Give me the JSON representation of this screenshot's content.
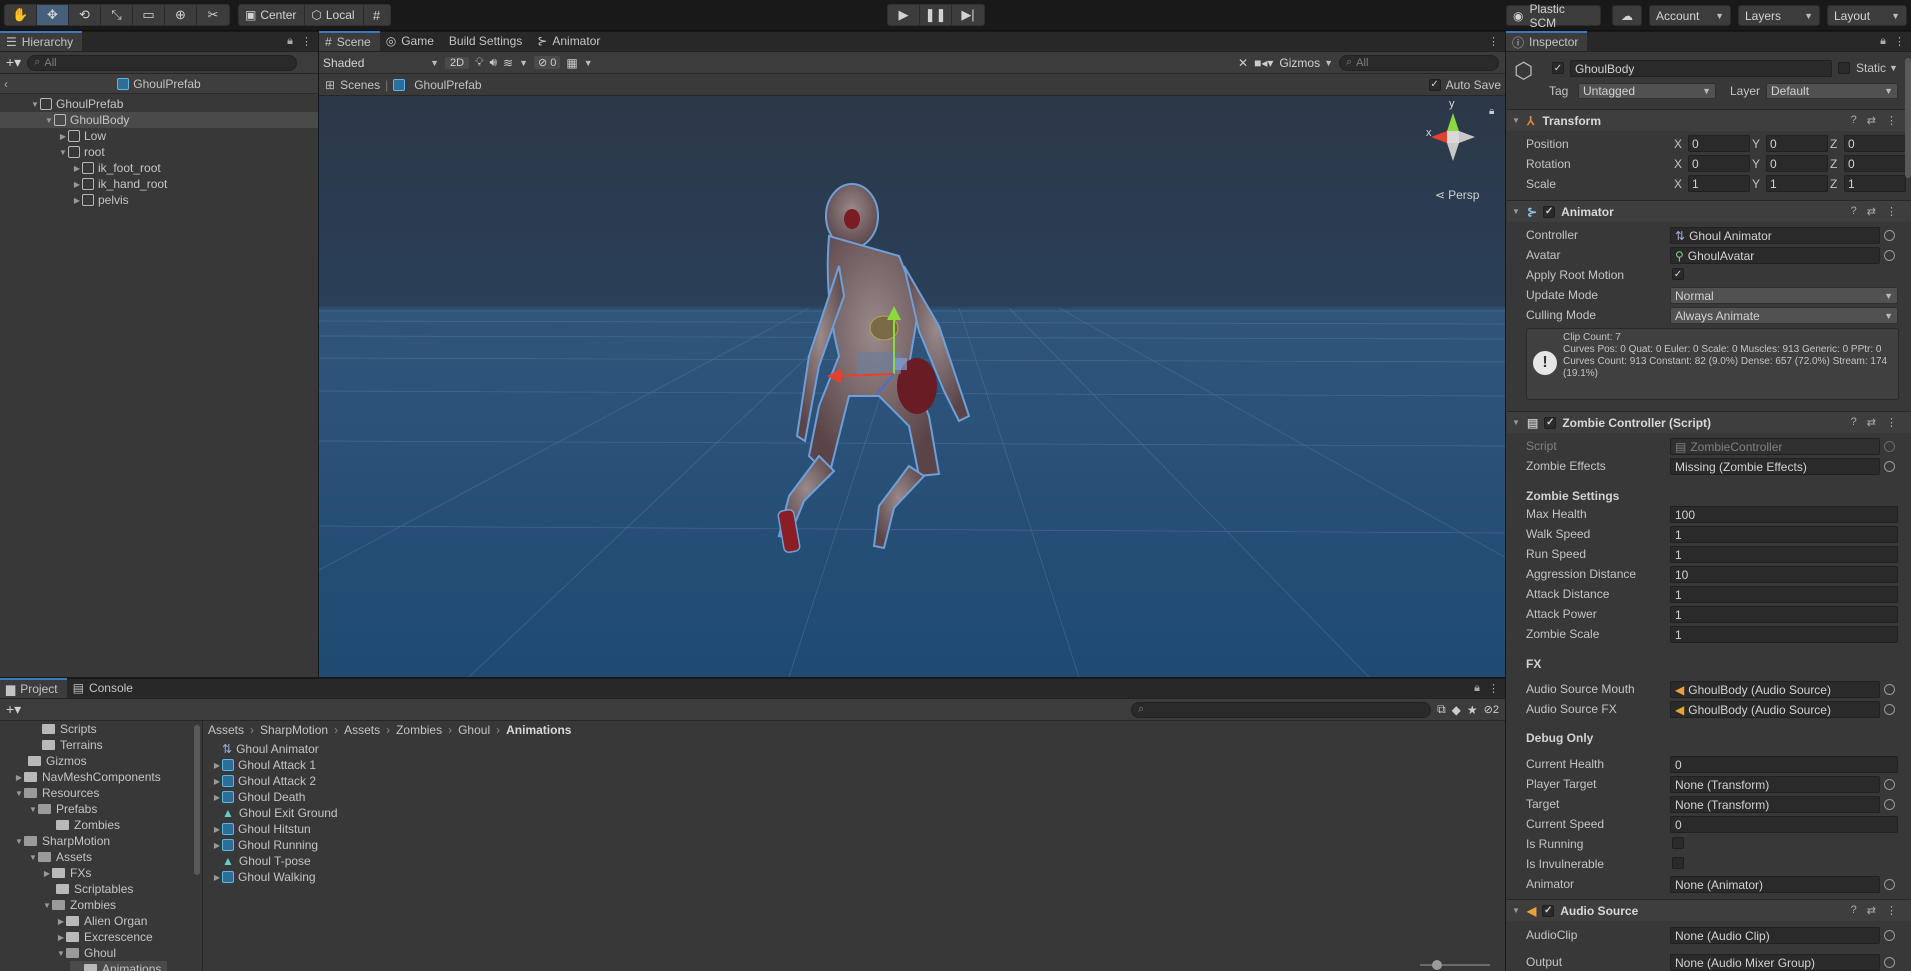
{
  "toolbar": {
    "pivot_label": "Center",
    "space_label": "Local",
    "plastic_label": "Plastic SCM",
    "account_label": "Account",
    "layers_label": "Layers",
    "layout_label": "Layout"
  },
  "hierarchy": {
    "tab": "Hierarchy",
    "search_placeholder": "All",
    "prefab_title": "GhoulPrefab",
    "items": [
      {
        "label": "GhoulPrefab"
      },
      {
        "label": "GhoulBody"
      },
      {
        "label": "Low"
      },
      {
        "label": "root"
      },
      {
        "label": "ik_foot_root"
      },
      {
        "label": "ik_hand_root"
      },
      {
        "label": "pelvis"
      }
    ]
  },
  "scene_tabs": {
    "scene": "Scene",
    "game": "Game",
    "build": "Build Settings",
    "animator": "Animator"
  },
  "scene_bar": {
    "shading": "Shaded",
    "mode2d": "2D",
    "hidden_count": "0",
    "gizmos": "Gizmos",
    "search_placeholder": "All",
    "breadcrumb_root": "Scenes",
    "breadcrumb_prefab": "GhoulPrefab",
    "autosave": "Auto Save",
    "persp": "Persp",
    "axis_x": "x",
    "axis_y": "y"
  },
  "inspector": {
    "tab": "Inspector",
    "object_name": "GhoulBody",
    "static_label": "Static",
    "tag_label": "Tag",
    "tag_value": "Untagged",
    "layer_label": "Layer",
    "layer_value": "Default",
    "transform": {
      "title": "Transform",
      "position_label": "Position",
      "rotation_label": "Rotation",
      "scale_label": "Scale",
      "position": [
        "0",
        "0",
        "0"
      ],
      "rotation": [
        "0",
        "0",
        "0"
      ],
      "scale": [
        "1",
        "1",
        "1"
      ]
    },
    "animator": {
      "title": "Animator",
      "controller_label": "Controller",
      "controller_value": "Ghoul Animator",
      "avatar_label": "Avatar",
      "avatar_value": "GhoulAvatar",
      "apply_root_label": "Apply Root Motion",
      "update_label": "Update Mode",
      "update_value": "Normal",
      "culling_label": "Culling Mode",
      "culling_value": "Always Animate",
      "info_line1": "Clip Count: 7",
      "info_line2": "Curves Pos: 0 Quat: 0 Euler: 0 Scale: 0 Muscles: 913 Generic: 0 PPtr: 0",
      "info_line3": "Curves Count: 913 Constant: 82 (9.0%) Dense: 657 (72.0%) Stream: 174 (19.1%)"
    },
    "zombie": {
      "title": "Zombie Controller (Script)",
      "script_label": "Script",
      "script_value": "ZombieController",
      "effects_label": "Zombie Effects",
      "effects_value": "Missing (Zombie Effects)",
      "settings_header": "Zombie Settings",
      "max_health_label": "Max Health",
      "max_health": "100",
      "walk_speed_label": "Walk Speed",
      "walk_speed": "1",
      "run_speed_label": "Run Speed",
      "run_speed": "1",
      "aggression_label": "Aggression Distance",
      "aggression": "10",
      "attack_distance_label": "Attack Distance",
      "attack_distance": "1",
      "attack_power_label": "Attack Power",
      "attack_power": "1",
      "zombie_scale_label": "Zombie Scale",
      "zombie_scale": "1",
      "fx_header": "FX",
      "audio_mouth_label": "Audio Source Mouth",
      "audio_mouth_value": "GhoulBody (Audio Source)",
      "audio_fx_label": "Audio Source FX",
      "audio_fx_value": "GhoulBody (Audio Source)",
      "debug_header": "Debug Only",
      "current_health_label": "Current Health",
      "current_health": "0",
      "player_target_label": "Player Target",
      "player_target": "None (Transform)",
      "target_label": "Target",
      "target": "None (Transform)",
      "current_speed_label": "Current Speed",
      "current_speed": "0",
      "is_running_label": "Is Running",
      "is_invulnerable_label": "Is Invulnerable",
      "animator_label": "Animator",
      "animator_value": "None (Animator)"
    },
    "audio": {
      "title": "Audio Source",
      "clip_label": "AudioClip",
      "clip_value": "None (Audio Clip)",
      "output_label": "Output",
      "output_value": "None (Audio Mixer Group)"
    }
  },
  "project": {
    "tab_project": "Project",
    "tab_console": "Console",
    "hidden_count": "2",
    "tree": [
      {
        "label": "Scripts"
      },
      {
        "label": "Terrains"
      },
      {
        "label": "Gizmos"
      },
      {
        "label": "NavMeshComponents"
      },
      {
        "label": "Resources"
      },
      {
        "label": "Prefabs"
      },
      {
        "label": "Zombies"
      },
      {
        "label": "SharpMotion"
      },
      {
        "label": "Assets"
      },
      {
        "label": "FXs"
      },
      {
        "label": "Scriptables"
      },
      {
        "label": "Zombies"
      },
      {
        "label": "Alien Organ"
      },
      {
        "label": "Excrescence"
      },
      {
        "label": "Ghoul"
      },
      {
        "label": "Animations"
      }
    ],
    "breadcrumb": [
      "Assets",
      "SharpMotion",
      "Assets",
      "Zombies",
      "Ghoul",
      "Animations"
    ],
    "assets": [
      {
        "label": "Ghoul Animator"
      },
      {
        "label": "Ghoul Attack 1"
      },
      {
        "label": "Ghoul Attack 2"
      },
      {
        "label": "Ghoul Death"
      },
      {
        "label": "Ghoul Exit Ground"
      },
      {
        "label": "Ghoul Hitstun"
      },
      {
        "label": "Ghoul Running"
      },
      {
        "label": "Ghoul T-pose"
      },
      {
        "label": "Ghoul Walking"
      }
    ]
  }
}
